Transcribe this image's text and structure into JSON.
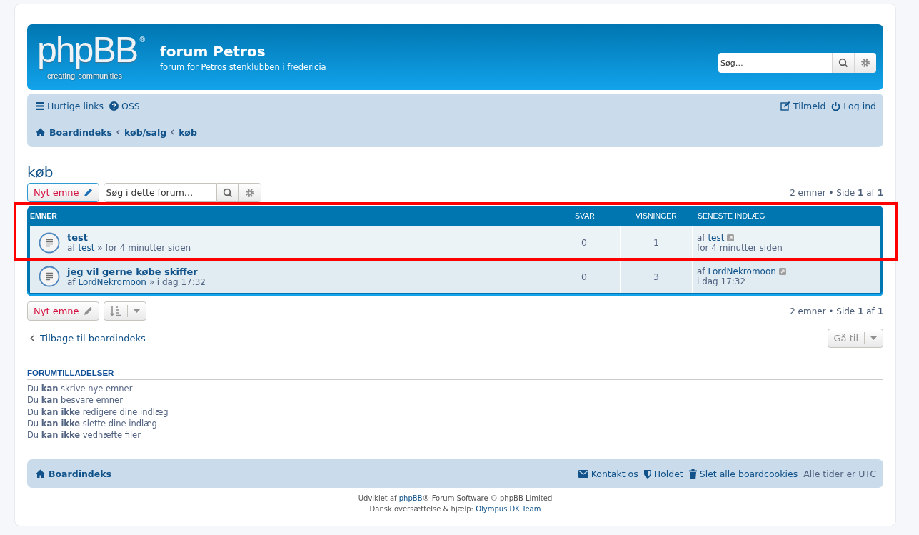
{
  "header": {
    "logo": {
      "word": "phpBB",
      "mark": "®",
      "tagline_left": "creating",
      "tagline_right": "communities"
    },
    "site_title": "forum Petros",
    "site_description": "forum for Petros stenklubben i fredericia",
    "search": {
      "placeholder": "Søg…"
    }
  },
  "navbar": {
    "quick_links": "Hurtige links",
    "faq": "OSS",
    "register": "Tilmeld",
    "login": "Log ind",
    "breadcrumbs": [
      "Boardindeks",
      "køb/salg",
      "køb"
    ]
  },
  "forum_title": "køb",
  "top_actions": {
    "new_topic": "Nyt emne",
    "search_placeholder": "Søg i dette forum…",
    "pagination": "2 emner • Side **1** af **1**"
  },
  "table": {
    "columns": [
      "EMNER",
      "SVAR",
      "VISNINGER",
      "SENESTE INDLÆG"
    ],
    "rows": [
      {
        "title": "test",
        "by_label": "af",
        "author": "test",
        "separator": "»",
        "time": "for 4 minutter siden",
        "replies": "0",
        "views": "1",
        "last_by_label": "af",
        "last_by": "test",
        "last_time": "for 4 minutter siden"
      },
      {
        "title": "jeg vil gerne købe skiffer",
        "by_label": "af",
        "author": "LordNekromoon",
        "separator": "»",
        "time": "i dag 17:32",
        "replies": "0",
        "views": "3",
        "last_by_label": "af",
        "last_by": "LordNekromoon",
        "last_time": "i dag 17:32"
      }
    ]
  },
  "bottom_actions": {
    "new_topic": "Nyt emne",
    "pagination": "2 emner • Side **1** af **1**",
    "back_link": "Tilbage til boardindeks",
    "jump_to": "Gå til"
  },
  "permissions": {
    "heading": "FORUMTILLADELSER",
    "lines": [
      "Du **kan** skrive nye emner",
      "Du **kan** besvare emner",
      "Du **kan ikke** redigere dine indlæg",
      "Du **kan ikke** slette dine indlæg",
      "Du **kan ikke** vedhæfte filer"
    ]
  },
  "footer_nav": {
    "home": "Boardindeks",
    "contact": "Kontakt os",
    "team": "Holdet",
    "delete_cookies": "Slet alle boardcookies",
    "timezone": "Alle tider er UTC"
  },
  "credits": [
    {
      "before": "Udviklet af ",
      "link": "phpBB",
      "after": "® Forum Software © phpBB Limited"
    },
    {
      "before": "Dansk oversættelse & hjælp: ",
      "link": "Olympus DK Team"
    }
  ],
  "annotation": {
    "kind": "highlight-frame",
    "color": "#ff0000"
  }
}
